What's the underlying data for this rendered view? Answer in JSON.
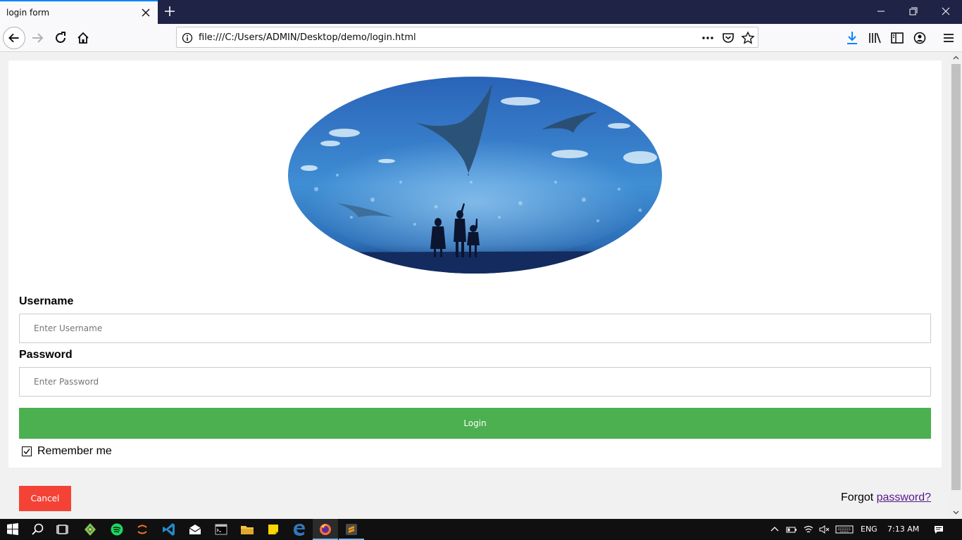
{
  "browser": {
    "tab_title": "login form",
    "url": "file:///C:/Users/ADMIN/Desktop/demo/login.html"
  },
  "form": {
    "username_label": "Username",
    "username_placeholder": "Enter Username",
    "password_label": "Password",
    "password_placeholder": "Enter Password",
    "login_label": "Login",
    "remember_label": "Remember me",
    "remember_checked": true,
    "cancel_label": "Cancel",
    "forgot_prefix": "Forgot ",
    "forgot_link": "password?"
  },
  "colors": {
    "login_button": "#4caf50",
    "cancel_button": "#f44336",
    "link": "#551a8b",
    "tab_accent": "#0a84ff"
  },
  "taskbar": {
    "language": "ENG",
    "time": "7:13 AM",
    "apps": [
      "windows-start-icon",
      "search-icon",
      "task-view-icon",
      "gitkraken-icon",
      "spotify-icon",
      "jupyter-icon",
      "vscode-icon",
      "mail-icon",
      "terminal-icon",
      "file-explorer-icon",
      "sticky-notes-icon",
      "edge-icon",
      "firefox-icon",
      "sublime-text-icon"
    ]
  }
}
